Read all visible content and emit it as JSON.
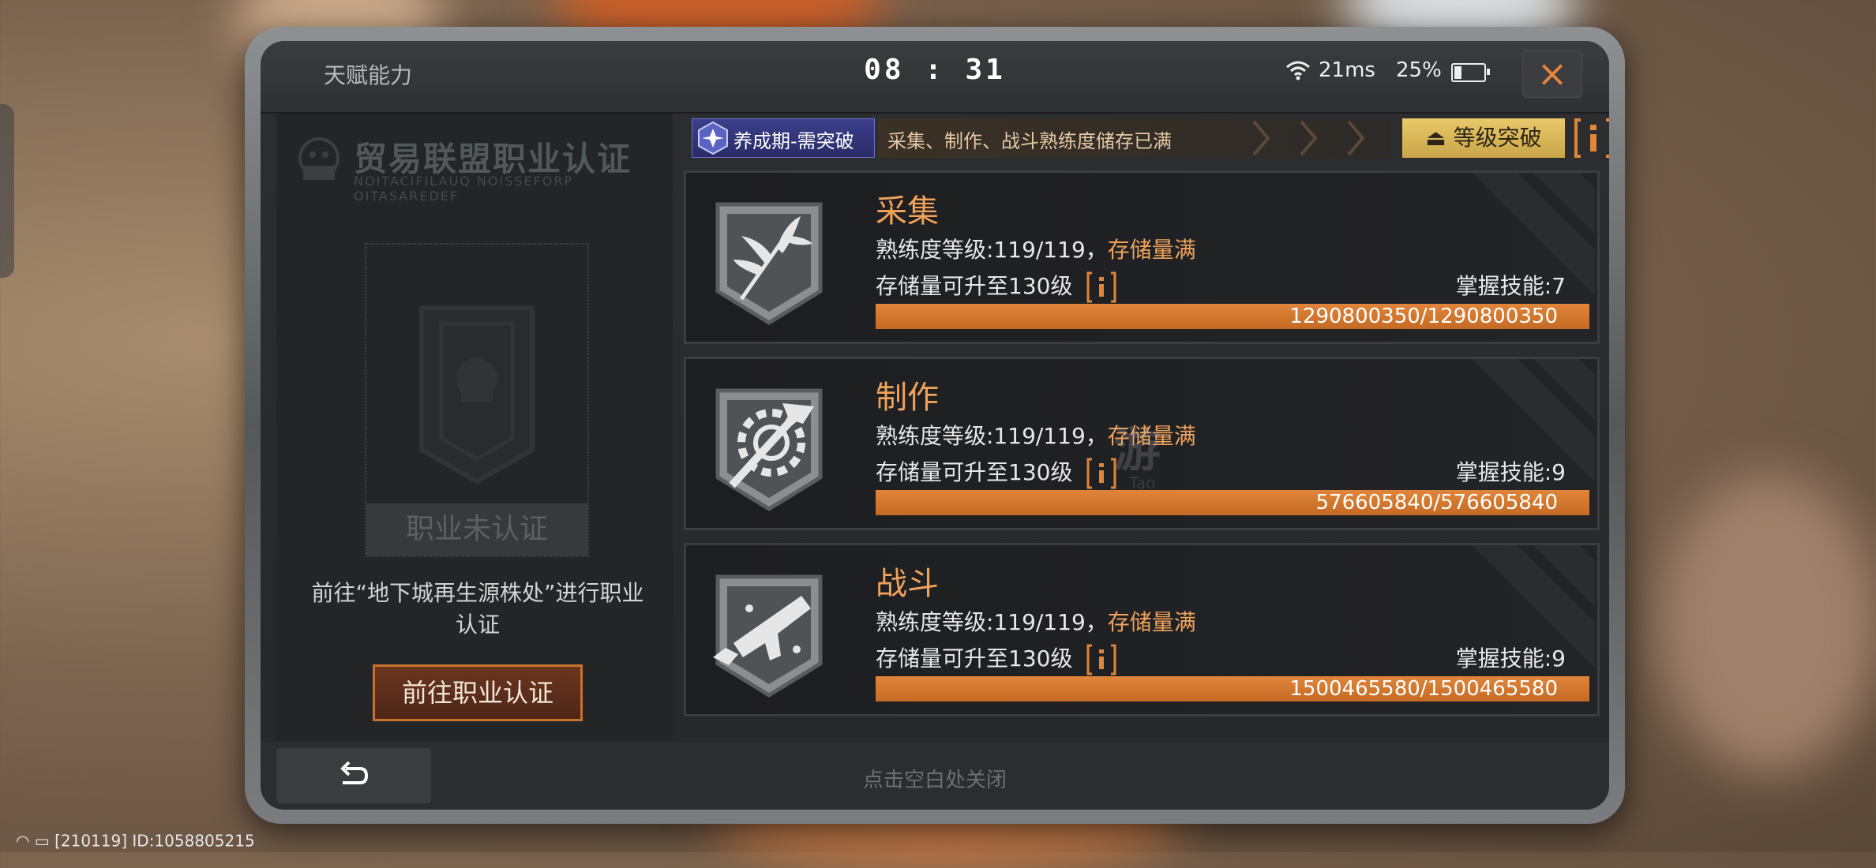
{
  "statusbar": {
    "title": "天赋能力",
    "clock": "08 : 31",
    "ping": "21ms",
    "battery_pct": "25%",
    "battery_level": 0.25,
    "close_icon": "×"
  },
  "left_panel": {
    "title": "贸易联盟职业认证",
    "subtitle": "NOITACIFILAUQ NOISSEFORP OITASAREDEF",
    "cert_status": "职业未认证",
    "description": "前往“地下城再生源株处”进行职业认证",
    "goto_button": "前往职业认证"
  },
  "header": {
    "stage_badge": "养成期-需突破",
    "strip_text": "采集、制作、战斗熟练度储存已满",
    "breakthrough_button": "等级突破",
    "accent": "#c9a548"
  },
  "skills": [
    {
      "name": "采集",
      "level_prefix": "熟练度等级:119/119，",
      "level_full": "存储量满",
      "upgrade": "存储量可升至130级",
      "skill_count": "掌握技能:7",
      "progress_text": "1290800350/1290800350",
      "progress": 1.0,
      "icon": "leaf-icon"
    },
    {
      "name": "制作",
      "level_prefix": "熟练度等级:119/119，",
      "level_full": "存储量满",
      "upgrade": "存储量可升至130级",
      "skill_count": "掌握技能:9",
      "progress_text": "576605840/576605840",
      "progress": 1.0,
      "icon": "hammer-gear-icon"
    },
    {
      "name": "战斗",
      "level_prefix": "熟练度等级:119/119，",
      "level_full": "存储量满",
      "upgrade": "存储量可升至130级",
      "skill_count": "掌握技能:9",
      "progress_text": "1500465580/1500465580",
      "progress": 1.0,
      "icon": "gun-icon"
    }
  ],
  "watermark": {
    "text": "游",
    "sub": "Tao"
  },
  "bottom": {
    "tap_close": "点击空白处关闭"
  },
  "footer": {
    "id_text": "[210119] ID:1058805215"
  },
  "colors": {
    "orange": "#e0853a",
    "gold": "#c9a548",
    "badge_blue": "#3b3f8c"
  }
}
